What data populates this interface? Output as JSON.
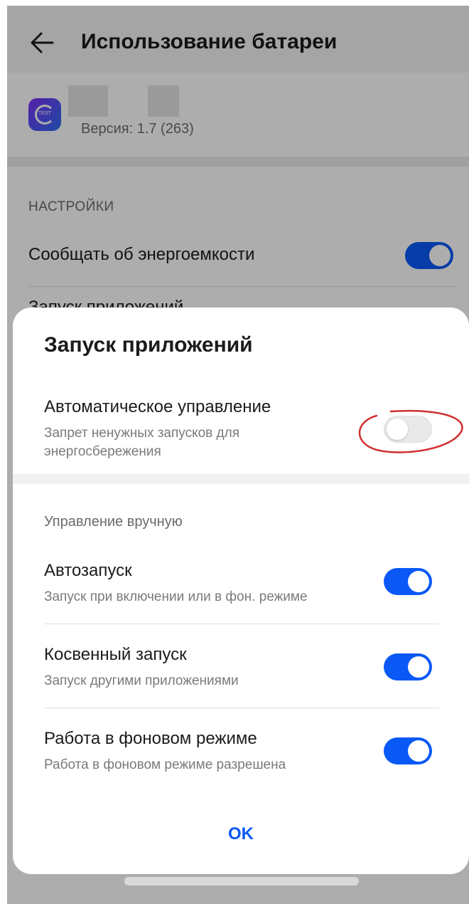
{
  "header": {
    "title": "Использование батареи",
    "back_icon": "arrow-left-icon"
  },
  "app": {
    "version": "Версия: 1.7 (263)",
    "icon_text": "TEST",
    "icon_colors": [
      "#7b2ff7",
      "#2f6ff2"
    ]
  },
  "settings": {
    "caption": "НАСТРОЙКИ",
    "notify_label": "Сообщать об энергоемкости",
    "notify_enabled": true,
    "launch_label": "Запуск приложений"
  },
  "dialog": {
    "title": "Запуск приложений",
    "auto": {
      "title": "Автоматическое управление",
      "subtitle": "Запрет ненужных запусков для энергосбережения",
      "enabled": false
    },
    "manual_caption": "Управление вручную",
    "rows": [
      {
        "title": "Автозапуск",
        "subtitle": "Запуск при включении или в фон. режиме",
        "enabled": true
      },
      {
        "title": "Косвенный запуск",
        "subtitle": "Запуск другими приложениями",
        "enabled": true
      },
      {
        "title": "Работа в фоновом режиме",
        "subtitle": "Работа в фоновом режиме разрешена",
        "enabled": true
      }
    ],
    "ok_label": "OK"
  },
  "colors": {
    "accent": "#0a59f7",
    "annotation": "#d0302f"
  }
}
